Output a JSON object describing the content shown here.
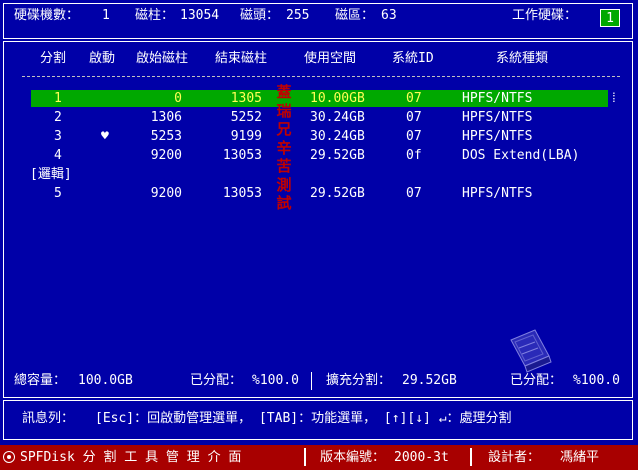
{
  "header": {
    "disk_count_label": "硬碟機數：",
    "disk_count": "1",
    "cylinder_label": "磁柱：",
    "cylinders": "13054",
    "head_label": "磁頭：",
    "heads": "255",
    "sector_label": "磁區：",
    "sectors": "63",
    "working_disk_label": "工作硬碟：",
    "working_disk": "1"
  },
  "table": {
    "columns": [
      "分割",
      "啟動",
      "啟始磁柱",
      "結束磁柱",
      "使用空間",
      "系統ID",
      "系統種類"
    ],
    "rows": [
      {
        "part": "1",
        "boot": "",
        "start": "0",
        "end": "1305",
        "size": "10.00GB",
        "id": "07",
        "fs": "HPFS/NTFS",
        "selected": true
      },
      {
        "part": "2",
        "boot": "",
        "start": "1306",
        "end": "5252",
        "size": "30.24GB",
        "id": "07",
        "fs": "HPFS/NTFS"
      },
      {
        "part": "3",
        "boot": "♥",
        "start": "5253",
        "end": "9199",
        "size": "30.24GB",
        "id": "07",
        "fs": "HPFS/NTFS"
      },
      {
        "part": "4",
        "boot": "",
        "start": "9200",
        "end": "13053",
        "size": "29.52GB",
        "id": "0f",
        "fs": "DOS Extend(LBA)"
      },
      {
        "part": "[邏輯]",
        "boot": "",
        "start": "",
        "end": "",
        "size": "",
        "id": "",
        "fs": ""
      },
      {
        "part": "5",
        "boot": "",
        "start": "9200",
        "end": "13053",
        "size": "29.52GB",
        "id": "07",
        "fs": "HPFS/NTFS"
      }
    ],
    "scroll_marker": "⁞"
  },
  "watermark": [
    "蓋",
    "瑞",
    "兄",
    "辛",
    "苦",
    "測",
    "試"
  ],
  "summary": {
    "total_label": "總容量：",
    "total": "100.0GB",
    "allocated_label": "已分配：",
    "allocated": "%100.0",
    "extended_label": "擴充分割：",
    "extended": "29.52GB",
    "ext_allocated_label": "已分配：",
    "ext_allocated": "%100.0"
  },
  "message": {
    "label": "訊息列：",
    "text": "[Esc]：回啟動管理選單，  [TAB]：功能選單，  [↑][↓] ↵：處理分割"
  },
  "status_bar": {
    "app": "SPFDisk 分 割 工 具 管 理 介 面",
    "version_label": "版本編號：",
    "version": "2000-3t",
    "designer_label": "設計者：",
    "designer": "馮緒平"
  },
  "colors": {
    "background": "#0000a8",
    "selection": "#00a800",
    "selected_text": "#ffff55",
    "status_bar": "#a80000",
    "watermark": "#c00000"
  }
}
